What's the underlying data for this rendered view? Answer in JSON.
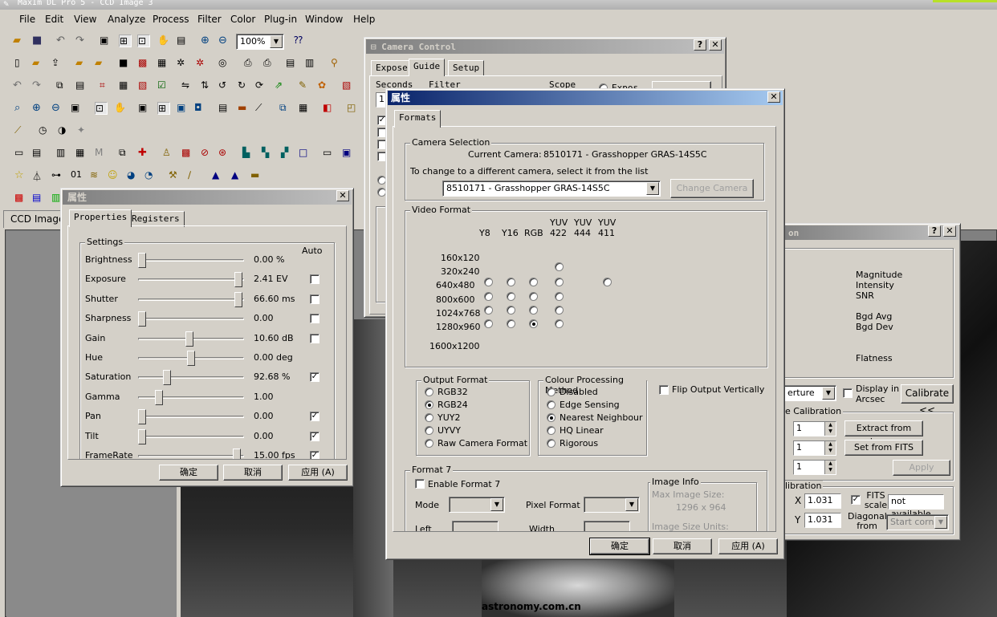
{
  "app": {
    "title": "MaxIm DL Pro 5 - CCD Image 3",
    "menu": [
      "File",
      "Edit",
      "View",
      "Analyze",
      "Process",
      "Filter",
      "Color",
      "Plug-in",
      "Window",
      "Help"
    ],
    "zoom": "100%",
    "image_tab": "CCD Image",
    "watermark": "astronomy.com.cn"
  },
  "camera_control": {
    "title": "Camera Control",
    "tabs": [
      "Expose",
      "Guide",
      "Setup"
    ],
    "labels": {
      "seconds": "Seconds",
      "filter": "Filter",
      "scope": "Scope",
      "expose_partial": "Expos"
    },
    "seconds_value": "1"
  },
  "formats_dialog": {
    "title": "属性",
    "tab": "Formats",
    "camera_selection": {
      "group": "Camera Selection",
      "current_label": "Current Camera:",
      "current_value": "8510171 - Grasshopper GRAS-14S5C",
      "hint": "To change to a different camera, select it from the list",
      "selected": "8510171 - Grasshopper GRAS-14S5C",
      "change_button": "Change Camera"
    },
    "video_format": {
      "group": "Video Format",
      "columns": [
        [
          "",
          "Y8"
        ],
        [
          "",
          "Y16"
        ],
        [
          "",
          "RGB"
        ],
        [
          "YUV",
          "422"
        ],
        [
          "YUV",
          "444"
        ],
        [
          "YUV",
          "411"
        ]
      ],
      "rows": [
        "160x120",
        "320x240",
        "640x480",
        "800x600",
        "1024x768",
        "1280x960",
        "1600x1200"
      ],
      "cells": [
        [
          0,
          0,
          0,
          0,
          0,
          0
        ],
        [
          0,
          0,
          0,
          1,
          0,
          0
        ],
        [
          1,
          1,
          1,
          1,
          0,
          1
        ],
        [
          1,
          1,
          1,
          1,
          0,
          0
        ],
        [
          1,
          1,
          1,
          1,
          0,
          0
        ],
        [
          1,
          1,
          2,
          1,
          0,
          0
        ],
        [
          0,
          0,
          0,
          0,
          0,
          0
        ]
      ]
    },
    "output_format": {
      "group": "Output Format",
      "options": [
        "RGB32",
        "RGB24",
        "YUY2",
        "UYVY",
        "Raw Camera Format"
      ],
      "selected": 1
    },
    "colour_processing": {
      "group": "Colour Processing Method",
      "options": [
        "Disabled",
        "Edge Sensing",
        "Nearest Neighbour",
        "HQ Linear",
        "Rigorous"
      ],
      "selected": 2
    },
    "flip_label": "Flip Output Vertically",
    "format7": {
      "group": "Format 7",
      "enable_label": "Enable Format 7",
      "mode_label": "Mode",
      "pixel_format_label": "Pixel Format",
      "left_label": "Left",
      "width_label": "Width"
    },
    "image_info": {
      "group": "Image Info",
      "max_size_label": "Max Image Size:",
      "max_size_value": "1296 x 964",
      "units_label": "Image Size Units:"
    },
    "buttons": {
      "ok": "确定",
      "cancel": "取消",
      "apply": "应用 (A)"
    }
  },
  "properties_dialog": {
    "title": "属性",
    "tabs": [
      "Properties",
      "Registers"
    ],
    "group": "Settings",
    "auto_label": "Auto",
    "settings": [
      {
        "name": "Brightness",
        "value": "0.00 %",
        "pos": 0.0,
        "auto": null
      },
      {
        "name": "Exposure",
        "value": "2.41 EV",
        "pos": 0.98,
        "auto": false
      },
      {
        "name": "Shutter",
        "value": "66.60 ms",
        "pos": 0.98,
        "auto": false
      },
      {
        "name": "Sharpness",
        "value": "0.00",
        "pos": 0.0,
        "auto": false
      },
      {
        "name": "Gain",
        "value": "10.60 dB",
        "pos": 0.48,
        "auto": false
      },
      {
        "name": "Hue",
        "value": "0.00 deg",
        "pos": 0.5,
        "auto": null
      },
      {
        "name": "Saturation",
        "value": "92.68 %",
        "pos": 0.25,
        "auto": true
      },
      {
        "name": "Gamma",
        "value": "1.00",
        "pos": 0.17,
        "auto": null
      },
      {
        "name": "Pan",
        "value": "0.00",
        "pos": 0.0,
        "auto": true
      },
      {
        "name": "Tilt",
        "value": "0.00",
        "pos": 0.0,
        "auto": true
      },
      {
        "name": "FrameRate",
        "value": "15.00 fps",
        "pos": 0.97,
        "auto": true
      }
    ],
    "buttons": {
      "ok": "确定",
      "cancel": "取消",
      "apply": "应用 (A)"
    }
  },
  "information_window": {
    "title_fragment": "on",
    "stats": [
      "Magnitude",
      "Intensity",
      "SNR",
      "Bgd Avg",
      "Bgd Dev",
      "Flatness"
    ],
    "mode_select": "erture",
    "display_arcsec": "Display in Arcsec",
    "calibrate_button": "Calibrate <<",
    "calibration_group": "e Calibration",
    "spin_values": [
      "1",
      "1",
      "1"
    ],
    "extract_button": "Extract from image",
    "set_fits_button": "Set from FITS",
    "apply_button": "Apply",
    "calibration2_group": "libration",
    "x_label": "X",
    "x_value": "1.031",
    "y_label": "Y",
    "y_value": "1.031",
    "fits_scale": "FITS scale",
    "not_available": "not available",
    "diagonal_from": "Diagonal from",
    "start_corner": "Start corner"
  }
}
